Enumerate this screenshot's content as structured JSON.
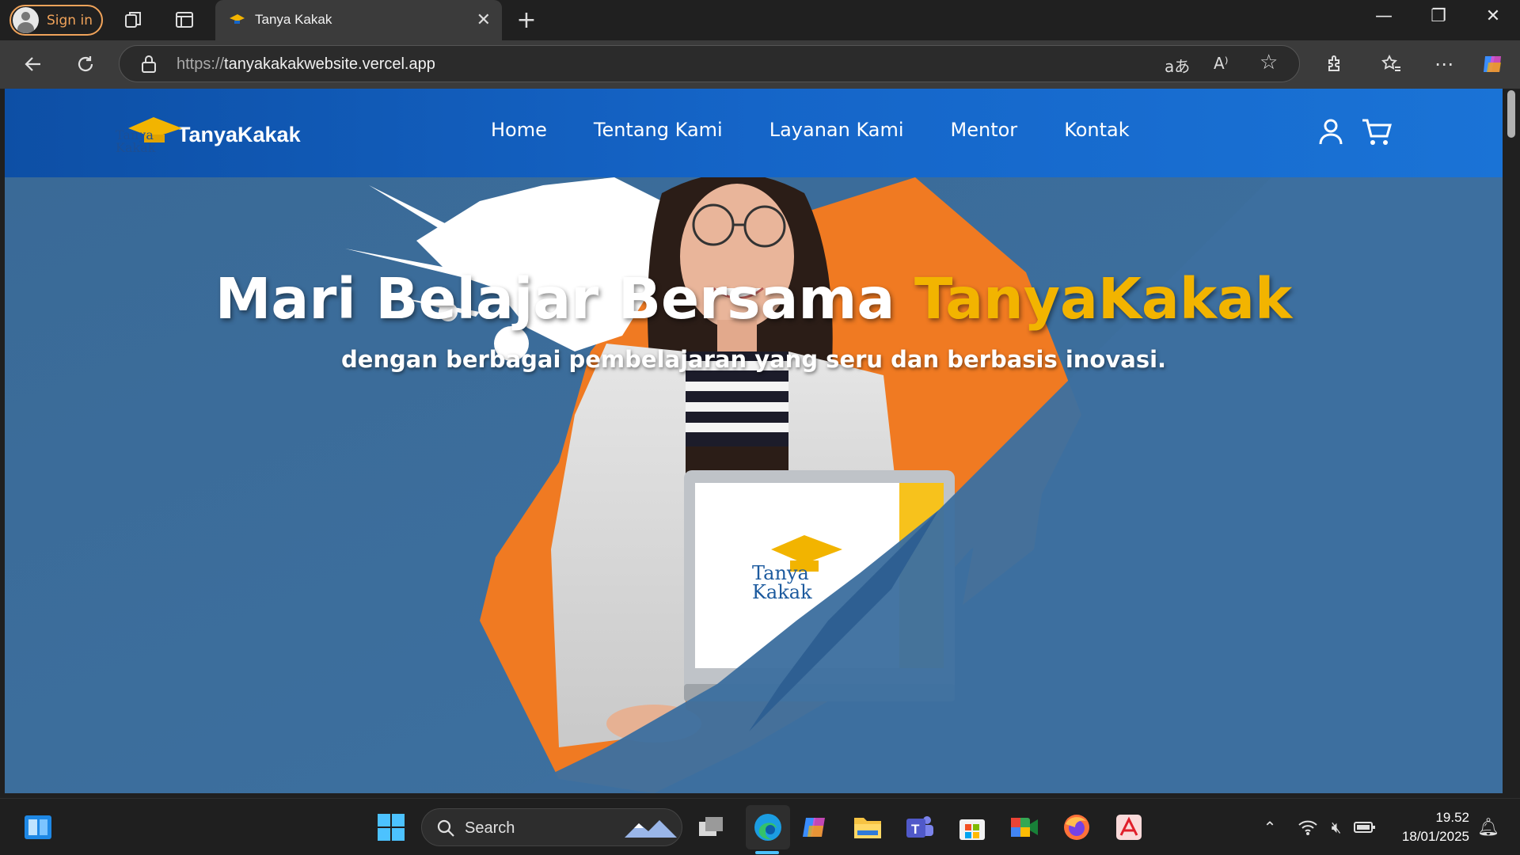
{
  "browser": {
    "signin_label": "Sign in",
    "tab_title": "Tanya Kakak",
    "url_prefix": "https://",
    "url_host": "tanyakakakwebsite.vercel.app"
  },
  "site": {
    "brand": "TanyaKakak",
    "logo_text_line1": "Tanya",
    "logo_text_line2": "Kakak",
    "nav": [
      "Home",
      "Tentang Kami",
      "Layanan Kami",
      "Mentor",
      "Kontak"
    ],
    "hero_title_main": "Mari Belajar Bersama ",
    "hero_title_accent": "TanyaKakak",
    "hero_subtitle": "dengan berbagai pembelajaran yang seru dan berbasis inovasi.",
    "laptop_logo_line1": "Tanya",
    "laptop_logo_line2": "Kakak",
    "colors": {
      "header_blue": "#1565c8",
      "hero_bg": "#3b6e9c",
      "accent_yellow": "#f2b400",
      "splash_orange": "#f07a22"
    }
  },
  "taskbar": {
    "search_placeholder": "Search",
    "time": "19.52",
    "date": "18/01/2025",
    "apps": [
      "start-icon",
      "file-explorer-icon",
      "edge-icon",
      "copilot-icon",
      "folder-icon",
      "teams-icon",
      "store-icon",
      "meet-icon",
      "firefox-icon",
      "acrobat-icon"
    ]
  }
}
